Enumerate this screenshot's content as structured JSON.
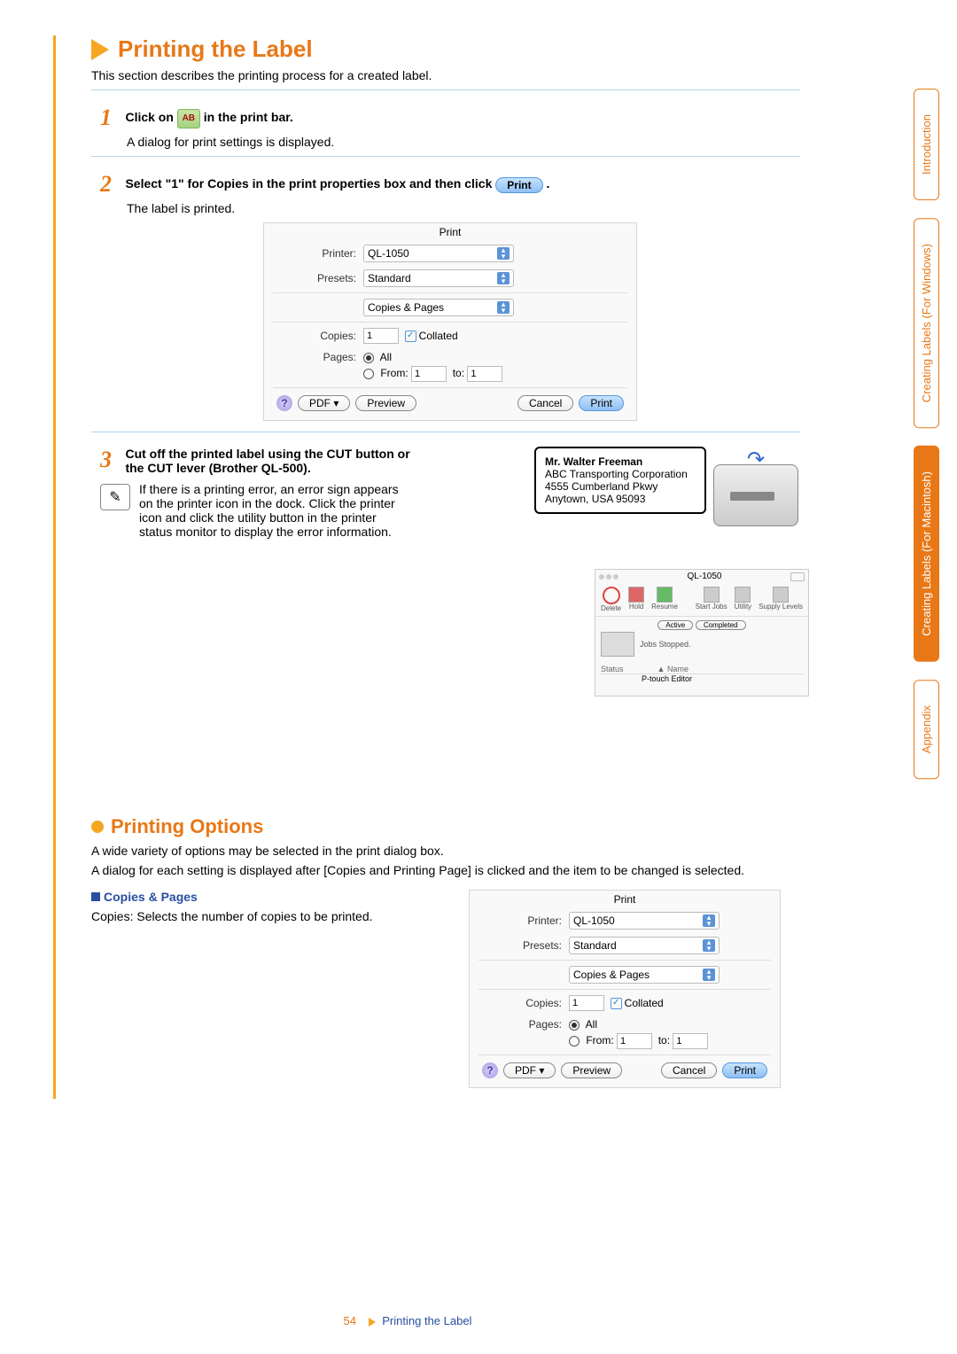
{
  "page_title": "Printing the Label",
  "intro": "This section describes the printing process for a created label.",
  "step1": {
    "text_before_icon": "Click on",
    "text_after_icon": " in the print bar.",
    "icon_label": "AB",
    "body": "A dialog for print settings is displayed."
  },
  "step2": {
    "head_before": "Select \"1\" for Copies in the print properties box and then click ",
    "print_btn": "Print",
    "head_after": ".",
    "body": "The label is printed."
  },
  "dialog1": {
    "title": "Print",
    "printer_label": "Printer:",
    "printer_value": "QL-1050",
    "presets_label": "Presets:",
    "presets_value": "Standard",
    "section": "Copies & Pages",
    "copies_label": "Copies:",
    "copies_value": "1",
    "collated_label": "Collated",
    "pages_label": "Pages:",
    "all_label": "All",
    "from_label": "From:",
    "from_value": "1",
    "to_label": "to:",
    "to_value": "1",
    "help": "?",
    "pdf_btn": "PDF ▾",
    "preview_btn": "Preview",
    "cancel_btn": "Cancel",
    "print_btn": "Print"
  },
  "step3": {
    "head": "Cut off the printed label using the CUT button or the CUT lever (Brother QL-500).",
    "note": "If there is a printing error, an error sign appears on the printer icon in the dock. Click the printer icon and click the utility button in the printer status monitor to display the error information."
  },
  "label_card": {
    "name": "Mr. Walter Freeman",
    "line1": "ABC Transporting Corporation",
    "line2": "4555 Cumberland Pkwy",
    "line3": "Anytown, USA 95093"
  },
  "status_win": {
    "title": "QL-1050",
    "tb": {
      "delete": "Delete",
      "hold": "Hold",
      "resume": "Resume",
      "start_jobs": "Start Jobs",
      "utility": "Utility",
      "supply": "Supply Levels"
    },
    "active": "Active",
    "completed": "Completed",
    "jobs_stopped": "Jobs Stopped.",
    "col_status": "Status",
    "col_name": "Name",
    "row_name": "P-touch Editor"
  },
  "printing_options": {
    "title": "Printing Options",
    "para1": "A wide variety of options may be selected in the print dialog box.",
    "para2": "A dialog for each setting is displayed after [Copies and Printing Page] is clicked and the item to be changed is selected.",
    "copies_pages": "Copies & Pages",
    "copies_desc": "Copies: Selects the number of copies to be printed."
  },
  "footer": {
    "page_num": "54",
    "crumb": "Printing the Label"
  },
  "tabs": {
    "intro": "Introduction",
    "win": "Creating Labels (For Windows)",
    "mac": "Creating Labels (For Macintosh)",
    "appendix": "Appendix"
  }
}
